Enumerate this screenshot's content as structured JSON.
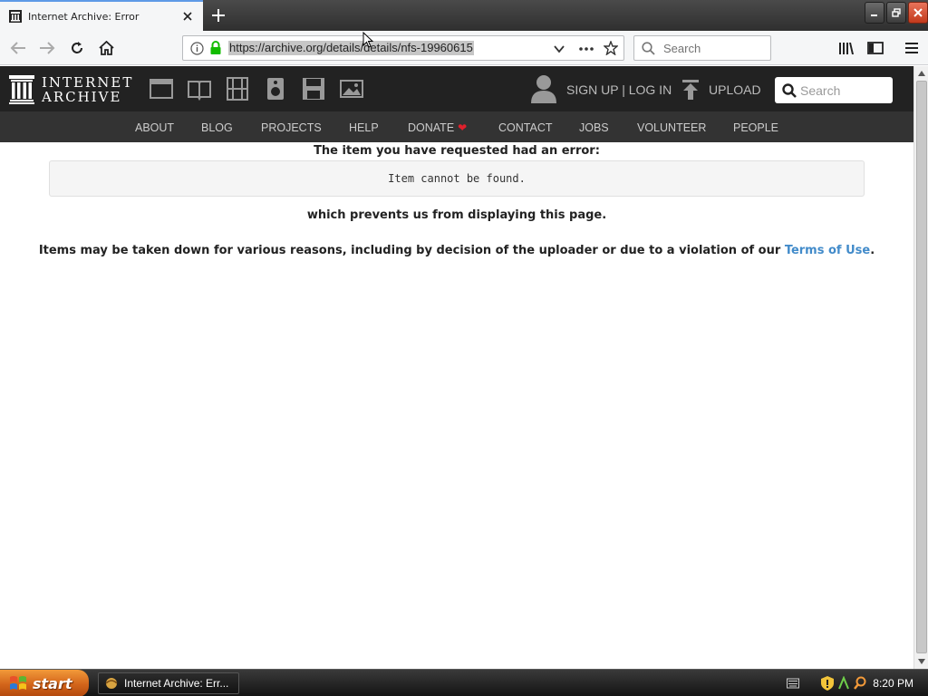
{
  "browser": {
    "tab_title": "Internet Archive: Error",
    "url": "https://archive.org/details/details/nfs-19960615",
    "search_placeholder": "Search"
  },
  "site": {
    "logo_line1": "INTERNET",
    "logo_line2": "ARCHIVE",
    "signup_login": "SIGN UP | LOG IN",
    "upload": "UPLOAD",
    "search_placeholder": "Search",
    "nav": [
      "ABOUT",
      "BLOG",
      "PROJECTS",
      "HELP",
      "DONATE",
      "CONTACT",
      "JOBS",
      "VOLUNTEER",
      "PEOPLE"
    ],
    "media_icons": [
      "web-icon",
      "texts-icon",
      "video-icon",
      "audio-icon",
      "software-icon",
      "images-icon"
    ]
  },
  "error": {
    "heading": "The item you have requested had an error:",
    "message": "Item cannot be found.",
    "prevents": "which prevents us from displaying this page.",
    "reasons_text": "Items may be taken down for various reasons, including by decision of the uploader or due to a violation of our ",
    "terms_link": "Terms of Use",
    "reasons_end": "."
  },
  "taskbar": {
    "start": "start",
    "task_label": "Internet Archive: Err...",
    "time": "8:20 PM"
  },
  "colors": {
    "accent_tab": "#5e9ae6",
    "ia_header": "#222222",
    "ia_nav": "#333333",
    "link": "#428bca",
    "heart": "#e0202c"
  }
}
